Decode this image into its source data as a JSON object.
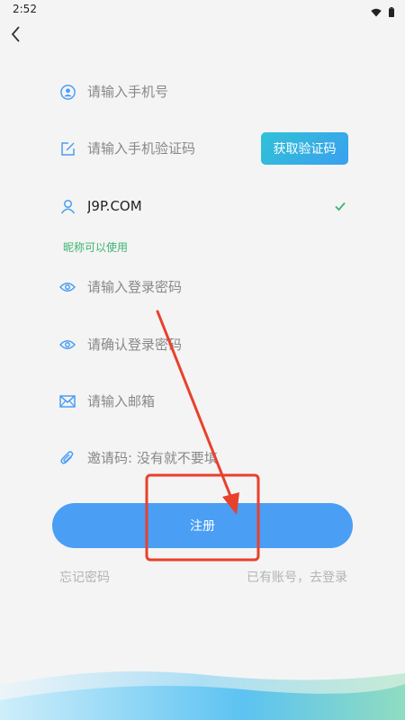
{
  "status_bar": {
    "time": "2:52",
    "icons": [
      "wifi-icon",
      "battery-icon"
    ]
  },
  "nav": {
    "back_icon": "chevron-left-icon"
  },
  "form": {
    "phone_placeholder": "请输入手机号",
    "code_placeholder": "请输入手机验证码",
    "get_code_label": "获取验证码",
    "nickname_value": "J9P.COM",
    "nickname_status": "昵称可以使用",
    "password_placeholder": "请输入登录密码",
    "confirm_password_placeholder": "请确认登录密码",
    "email_placeholder": "请输入邮箱",
    "invite_placeholder": "邀请码: 没有就不要填"
  },
  "actions": {
    "register_label": "注册",
    "forgot_password": "忘记密码",
    "have_account": "已有账号，去登录"
  },
  "colors": {
    "accent": "#4a9ef4",
    "success": "#3cb371",
    "annotation": "#e8412c"
  }
}
